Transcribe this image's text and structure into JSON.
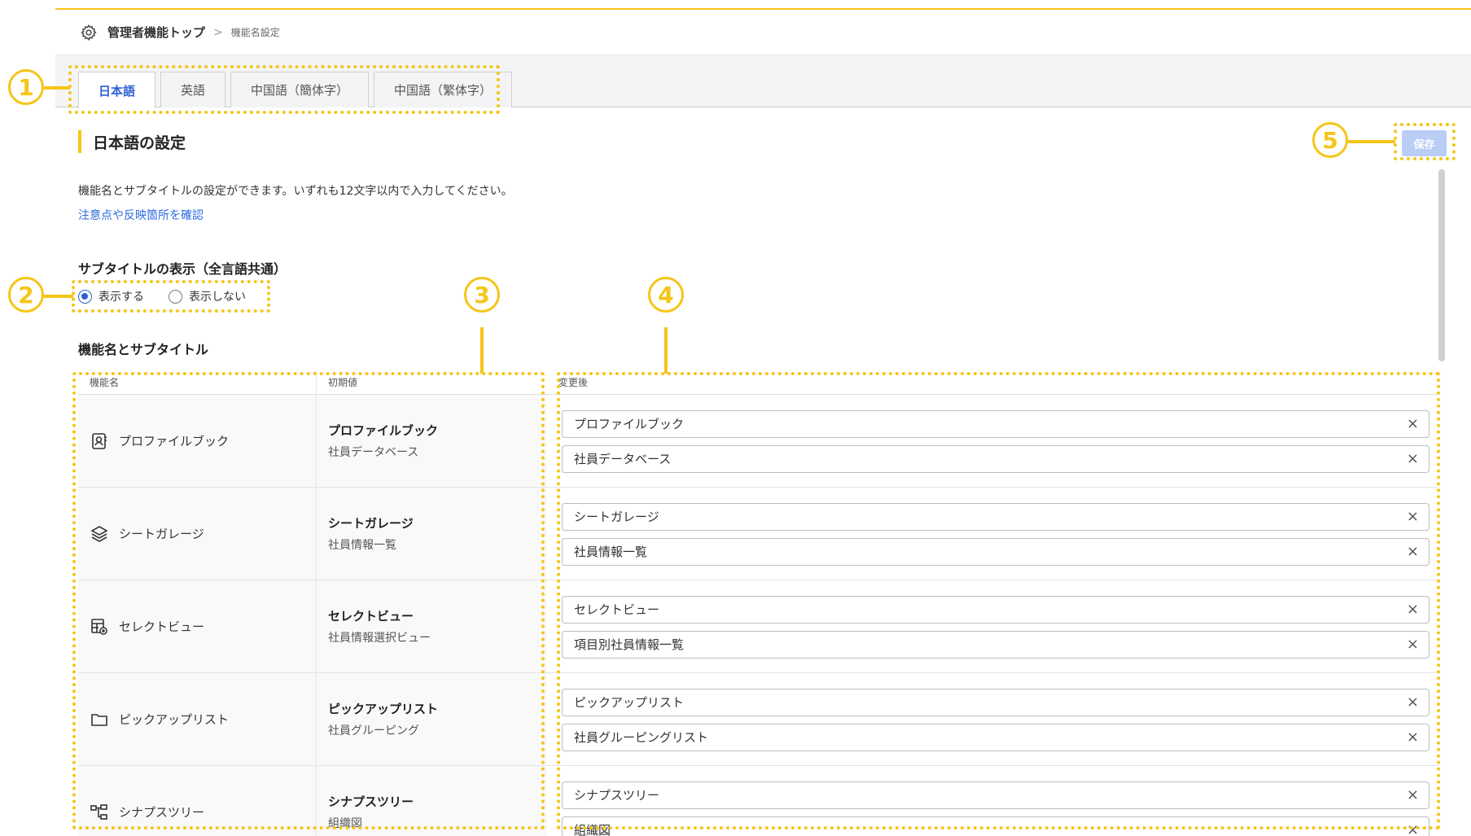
{
  "breadcrumb": {
    "root": "管理者機能トップ",
    "separator": ">",
    "current": "機能名設定"
  },
  "tabs": [
    "日本語",
    "英語",
    "中国語（簡体字）",
    "中国語（繁体字）"
  ],
  "section": {
    "title": "日本語の設定",
    "save_label": "保存"
  },
  "description": "機能名とサブタイトルの設定ができます。いずれも12文字以内で入力してください。",
  "link_text": "注意点や反映箇所を確認",
  "subtitle_display": {
    "heading": "サブタイトルの表示（全言語共通）",
    "options": [
      "表示する",
      "表示しない"
    ],
    "selected": "表示する"
  },
  "table_heading": "機能名とサブタイトル",
  "columns": [
    "機能名",
    "初期値",
    "変更後"
  ],
  "rows": [
    {
      "icon": "profile-book-icon",
      "feature": "プロファイルブック",
      "default_name": "プロファイルブック",
      "default_sub": "社員データベース",
      "new_name": "プロファイルブック",
      "new_sub": "社員データベース"
    },
    {
      "icon": "layers-icon",
      "feature": "シートガレージ",
      "default_name": "シートガレージ",
      "default_sub": "社員情報一覧",
      "new_name": "シートガレージ",
      "new_sub": "社員情報一覧"
    },
    {
      "icon": "table-add-icon",
      "feature": "セレクトビュー",
      "default_name": "セレクトビュー",
      "default_sub": "社員情報選択ビュー",
      "new_name": "セレクトビュー",
      "new_sub": "項目別社員情報一覧"
    },
    {
      "icon": "folder-icon",
      "feature": "ピックアップリスト",
      "default_name": "ピックアップリスト",
      "default_sub": "社員グルーピング",
      "new_name": "ピックアップリスト",
      "new_sub": "社員グルーピングリスト"
    },
    {
      "icon": "org-chart-icon",
      "feature": "シナプスツリー",
      "default_name": "シナプスツリー",
      "default_sub": "組織図",
      "new_name": "シナプスツリー",
      "new_sub": "組織図"
    }
  ],
  "annotations": [
    "1",
    "2",
    "3",
    "4",
    "5"
  ],
  "colors": {
    "accent": "#f5c518",
    "primary": "#2d5fd6",
    "save_disabled": "#b9cdf5"
  }
}
